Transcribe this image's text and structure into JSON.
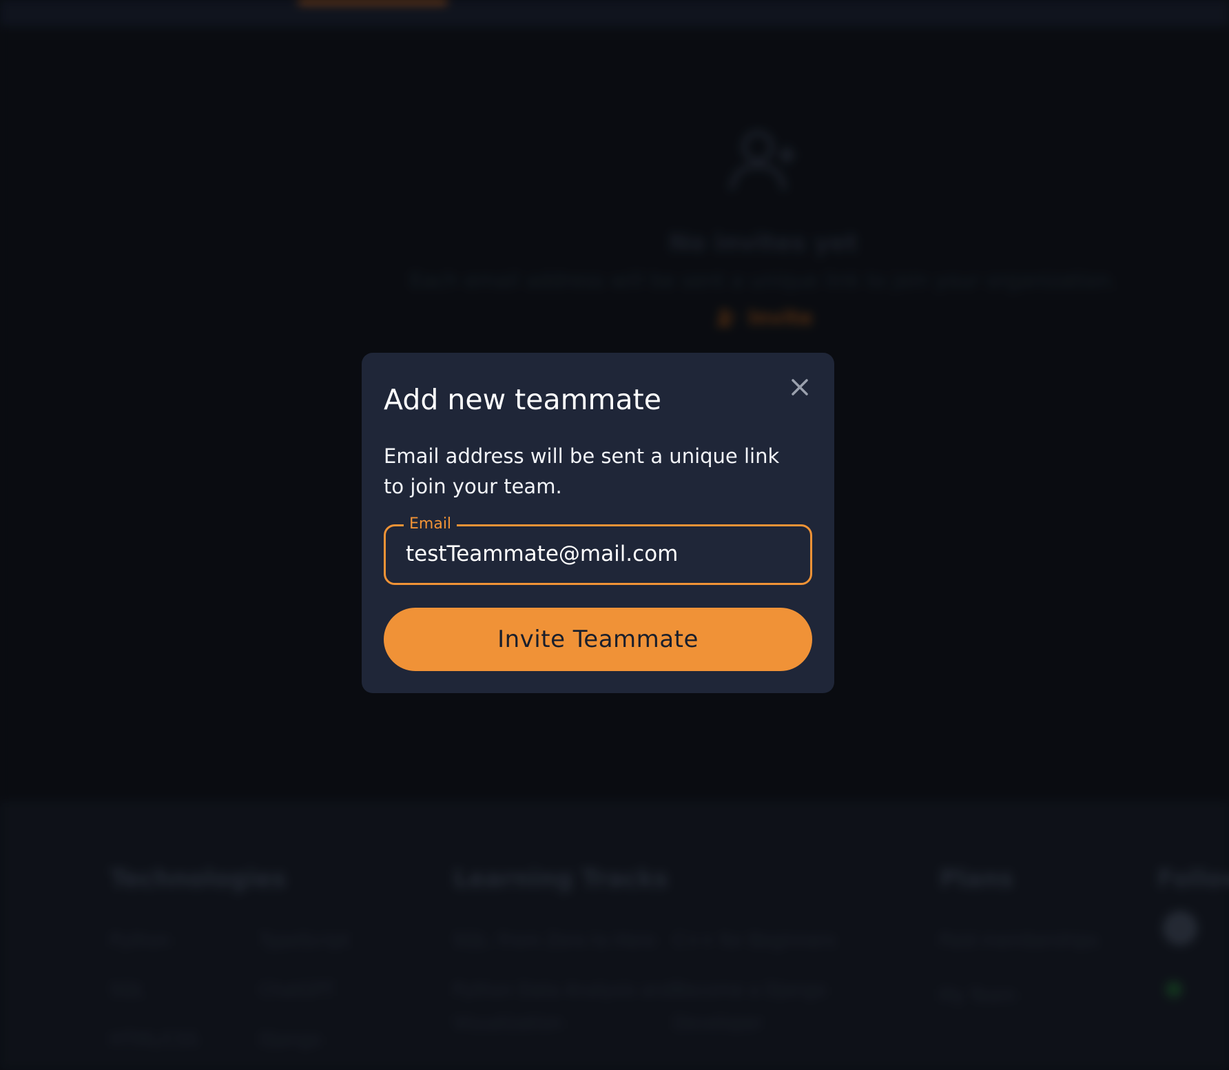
{
  "background": {
    "empty_state": {
      "icon": "user-plus-icon",
      "title": "No invites yet",
      "description": "Each email address will be sent a unique link to join your organization.",
      "invite_label": "Invite"
    },
    "footer": {
      "technologies": {
        "title": "Technologies",
        "links": [
          "Python",
          "TypeScript",
          "SQL",
          "ChatGPT",
          "HTML/CSS",
          "Django"
        ]
      },
      "learning_tracks": {
        "title": "Learning Tracks",
        "links": [
          "SQL: From Zero to Hero",
          "C++ for Beginners",
          "Python Data Analysis and",
          "Become a Django",
          "Visualization",
          "Developer"
        ]
      },
      "plans": {
        "title": "Plans",
        "links": [
          "Paid memberships",
          "My Team"
        ]
      },
      "follow": {
        "title": "Follow"
      }
    }
  },
  "modal": {
    "title": "Add new teammate",
    "description": "Email address will be sent a unique link to join your team.",
    "email": {
      "label": "Email",
      "value": "testTeammate@mail.com"
    },
    "submit_label": "Invite Teammate",
    "close_icon": "close-icon"
  },
  "colors": {
    "accent": "#f09237",
    "modal_bg": "#1f2638",
    "page_bg": "#0d1016"
  }
}
